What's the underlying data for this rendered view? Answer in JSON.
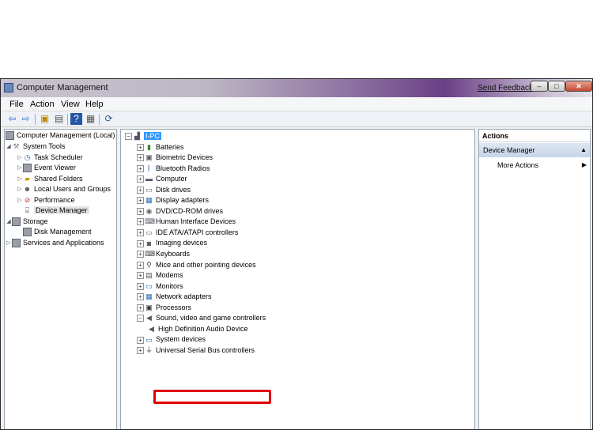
{
  "window": {
    "title": "Computer Management",
    "send_feedback": "Send Feedback",
    "min": "–",
    "max": "□",
    "close": "✕"
  },
  "menu": [
    "File",
    "Action",
    "View",
    "Help"
  ],
  "left_tree": {
    "root": "Computer Management (Local)",
    "system_tools": "System Tools",
    "task_scheduler": "Task Scheduler",
    "event_viewer": "Event Viewer",
    "shared_folders": "Shared Folders",
    "local_users": "Local Users and Groups",
    "performance": "Performance",
    "device_manager": "Device Manager",
    "storage": "Storage",
    "disk_management": "Disk Management",
    "services": "Services and Applications"
  },
  "device_tree": {
    "computer_name": "I-PC",
    "categories": [
      "Batteries",
      "Biometric Devices",
      "Bluetooth Radios",
      "Computer",
      "Disk drives",
      "Display adapters",
      "DVD/CD-ROM drives",
      "Human Interface Devices",
      "IDE ATA/ATAPI controllers",
      "Imaging devices",
      "Keyboards",
      "Mice and other pointing devices",
      "Modems",
      "Monitors",
      "Network adapters",
      "Processors",
      "Sound, video and game controllers",
      "High Definition Audio Device",
      "System devices",
      "Universal Serial Bus controllers"
    ]
  },
  "actions": {
    "header": "Actions",
    "section": "Device Manager",
    "more_actions": "More Actions"
  },
  "colors": {
    "selection": "#3399ff",
    "highlight_box": "#e00000"
  }
}
